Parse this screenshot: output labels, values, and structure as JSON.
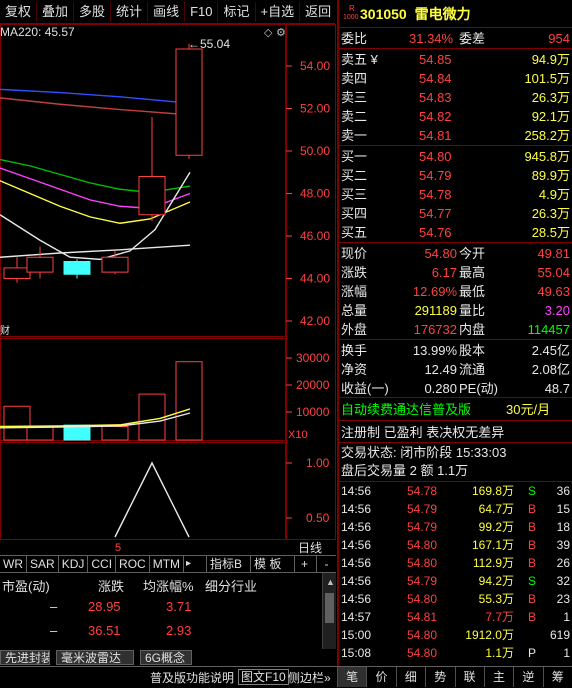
{
  "toolbar": {
    "items": [
      "复权",
      "叠加",
      "多股",
      "统计",
      "画线",
      "F10",
      "标记",
      "+自选",
      "返回"
    ]
  },
  "chart": {
    "ma_label": "MA220: 45.57",
    "peak_label": "55.04",
    "price_ticks": [
      "54.00",
      "52.00",
      "50.00",
      "48.00",
      "46.00",
      "44.00",
      "42.00"
    ],
    "vol_ticks": [
      "30000",
      "20000",
      "10000"
    ],
    "vol_unit": "X10",
    "ind_ticks": [
      "1.00",
      "0.50"
    ],
    "ind_marker": "5",
    "left_cut_label": "财",
    "linechart_label": "日线"
  },
  "tabs": {
    "items": [
      "WR",
      "SAR",
      "KDJ",
      "CCI",
      "ROC",
      "MTM"
    ],
    "more": "▸",
    "indicator": "指标B",
    "template": "模 板",
    "plus": "+",
    "minus": "-"
  },
  "table": {
    "headers": [
      "市盈(动)",
      "涨跌",
      "均涨幅%",
      "细分行业"
    ],
    "rows": [
      {
        "pe": "–",
        "change": "28.95",
        "avg": "3.71"
      },
      {
        "pe": "–",
        "change": "36.51",
        "avg": "2.93"
      }
    ]
  },
  "bottom_tabs": [
    "先进封装",
    "毫米波雷达",
    "6G概念"
  ],
  "status_bar": {
    "left": "普及版功能说明",
    "f10": "图文F10",
    "right": "侧边栏»"
  },
  "stock": {
    "badge_top": "R",
    "badge_bottom": "1000",
    "code": "301050",
    "name": "雷电微力"
  },
  "weibi": {
    "label": "委比",
    "value": "31.34%",
    "diff_label": "委差",
    "diff_value": "954"
  },
  "sell": [
    {
      "label": "卖五",
      "mark": "¥",
      "price": "54.85",
      "vol": "94.9万"
    },
    {
      "label": "卖四",
      "price": "54.84",
      "vol": "101.5万"
    },
    {
      "label": "卖三",
      "price": "54.83",
      "vol": "26.3万"
    },
    {
      "label": "卖二",
      "price": "54.82",
      "vol": "92.1万"
    },
    {
      "label": "卖一",
      "price": "54.81",
      "vol": "258.2万"
    }
  ],
  "buy": [
    {
      "label": "买一",
      "price": "54.80",
      "vol": "945.8万"
    },
    {
      "label": "买二",
      "price": "54.79",
      "vol": "89.9万"
    },
    {
      "label": "买三",
      "price": "54.78",
      "vol": "4.9万"
    },
    {
      "label": "买四",
      "price": "54.77",
      "vol": "26.3万"
    },
    {
      "label": "买五",
      "price": "54.76",
      "vol": "28.5万"
    }
  ],
  "stats": [
    {
      "l1": "现价",
      "v1": "54.80",
      "l2": "今开",
      "v2": "49.81"
    },
    {
      "l1": "涨跌",
      "v1": "6.17",
      "l2": "最高",
      "v2": "55.04"
    },
    {
      "l1": "涨幅",
      "v1": "12.69%",
      "l2": "最低",
      "v2": "49.63"
    },
    {
      "l1": "总量",
      "v1": "291189",
      "l2": "量比",
      "v2": "3.20"
    },
    {
      "l1": "外盘",
      "v1": "176732",
      "l2": "内盘",
      "v2": "114457"
    }
  ],
  "fin": [
    {
      "l1": "换手",
      "v1": "13.99%",
      "l2": "股本",
      "v2": "2.45亿"
    },
    {
      "l1": "净资",
      "v1": "12.49",
      "l2": "流通",
      "v2": "2.08亿"
    },
    {
      "l1": "收益(一)",
      "v1": "0.280",
      "l2": "PE(动)",
      "v2": "48.7"
    }
  ],
  "promo": {
    "text": "自动续费通达信普及版",
    "price": "30元/月"
  },
  "register": "注册制 已盈利 表决权无差异",
  "trade_status": "交易状态: 闭市阶段 15:33:03",
  "after_hours": "盘后交易量 2 额 1.1万",
  "ticks": [
    {
      "t": "14:56",
      "p": "54.78",
      "v": "169.8万",
      "s": "S",
      "n": "36"
    },
    {
      "t": "14:56",
      "p": "54.79",
      "v": "64.7万",
      "s": "B",
      "n": "15"
    },
    {
      "t": "14:56",
      "p": "54.79",
      "v": "99.2万",
      "s": "B",
      "n": "18"
    },
    {
      "t": "14:56",
      "p": "54.80",
      "v": "167.1万",
      "s": "B",
      "n": "39"
    },
    {
      "t": "14:56",
      "p": "54.80",
      "v": "112.9万",
      "s": "B",
      "n": "26"
    },
    {
      "t": "14:56",
      "p": "54.79",
      "v": "94.2万",
      "s": "S",
      "n": "32"
    },
    {
      "t": "14:56",
      "p": "54.80",
      "v": "55.3万",
      "s": "B",
      "n": "23"
    },
    {
      "t": "14:57",
      "p": "54.81",
      "v": "7.7万",
      "s": "B",
      "n": "1"
    },
    {
      "t": "15:00",
      "p": "54.80",
      "v": "1912.0万",
      "s": "",
      "n": "619"
    },
    {
      "t": "15:08",
      "p": "54.80",
      "v": "1.1万",
      "s": "P",
      "n": "1"
    }
  ],
  "right_tabs": [
    "笔",
    "价",
    "细",
    "势",
    "联",
    "主",
    "逆",
    "筹"
  ],
  "colors": {
    "up": "#ff4040",
    "down": "#00ff00",
    "border": "#800000",
    "ma_blue": "#3050ff",
    "cyan_bar": "#40ffff"
  }
}
